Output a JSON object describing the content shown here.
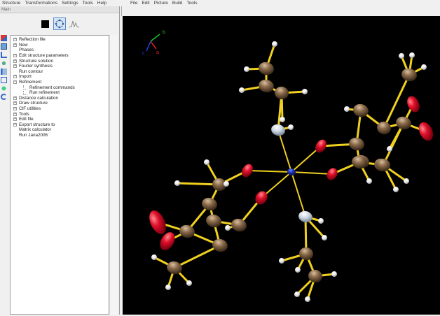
{
  "menu_left": [
    "Structure",
    "Transformations",
    "Settings",
    "Tools",
    "Help"
  ],
  "menu_right": [
    "File",
    "Edit",
    "Picture",
    "Build",
    "Tools"
  ],
  "panel_title": "Main",
  "tree": [
    {
      "label": "Reflection file",
      "expandable": true
    },
    {
      "label": "New",
      "expandable": true
    },
    {
      "label": "Phases",
      "expandable": false
    },
    {
      "label": "Edit structure parameters",
      "expandable": true
    },
    {
      "label": "Structure solution",
      "expandable": true
    },
    {
      "label": "Fourier synthesis",
      "expandable": true
    },
    {
      "label": "Run contour",
      "expandable": false
    },
    {
      "label": "Import",
      "expandable": true
    },
    {
      "label": "Refinement",
      "expandable": true,
      "expanded": true
    },
    {
      "label": "Refinement commands",
      "child": true
    },
    {
      "label": "Run refinement",
      "child": true
    },
    {
      "label": "Distance calculation",
      "expandable": true
    },
    {
      "label": "Draw structure",
      "expandable": true
    },
    {
      "label": "CIF utilities",
      "expandable": true
    },
    {
      "label": "Tools",
      "expandable": true
    },
    {
      "label": "Edit file",
      "expandable": true
    },
    {
      "label": "Export structure to",
      "expandable": true
    },
    {
      "label": "Matrix calculator",
      "expandable": false
    },
    {
      "label": "Run Jana2006",
      "expandable": false
    }
  ],
  "axes": {
    "a": "a",
    "b": "b",
    "c": "c"
  },
  "colors": {
    "viewer_bg": "#000000",
    "carbon": "#8a6a4a",
    "oxygen": "#e0102a",
    "nitrogen": "#d8dde8",
    "hydrogen": "#f2f2f2",
    "metal": "#1a2fb0",
    "bond": "#f0d020"
  }
}
